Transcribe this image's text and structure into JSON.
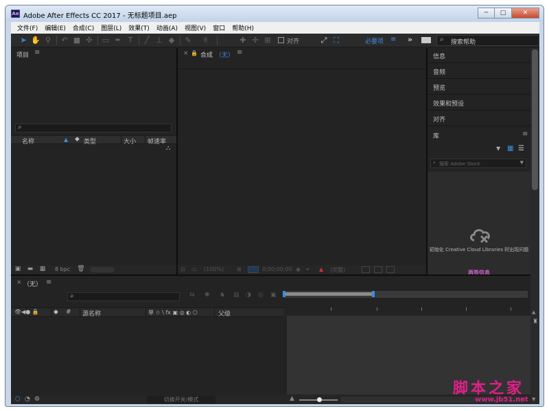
{
  "window": {
    "title": "Adobe After Effects CC 2017 - 无标题项目.aep",
    "app_icon_text": "Ae",
    "minimize": "─",
    "maximize": "□",
    "close": "✕"
  },
  "menu": [
    "文件(F)",
    "编辑(E)",
    "合成(C)",
    "图层(L)",
    "效果(T)",
    "动画(A)",
    "视图(V)",
    "窗口",
    "帮助(H)"
  ],
  "toolbar": {
    "snap_label": "对齐",
    "workspace": "必要项",
    "workspace_menu": "≡",
    "more": "»",
    "search_placeholder": "搜索帮助"
  },
  "project": {
    "title": "项目",
    "menu": "≡",
    "search_glass": "⌕",
    "columns": [
      "名称",
      "类型",
      "大小",
      "帧速率"
    ],
    "bpc": "8 bpc"
  },
  "composition": {
    "close": "×",
    "lock": "🔒",
    "title": "合成",
    "name": "（无）",
    "menu": "≡",
    "zoom": "(100%)",
    "timecode": "0;00;00;00",
    "resolution": "(完整)"
  },
  "right_panels": {
    "items": [
      "信息",
      "音频",
      "预览",
      "效果和预设",
      "对齐"
    ],
    "library_title": "库",
    "library_menu": "≡",
    "library_search": "搜索 Adobe Stock",
    "library_message": "初始化 Creative Cloud Libraries 时出现问题",
    "library_retry": "再签信息"
  },
  "timeline": {
    "close": "×",
    "name": "（无）",
    "menu": "≡",
    "search_glass": "⌕",
    "col_source": "源名称",
    "col_switches": "单 ☆ \\ fx ▣ ◎ ◐ ⬡",
    "col_parent": "父级",
    "col_hash": "#",
    "toggle_label": "切换开关/模式"
  },
  "watermark": {
    "text": "脚本之家",
    "url": "www.jb51.net"
  }
}
